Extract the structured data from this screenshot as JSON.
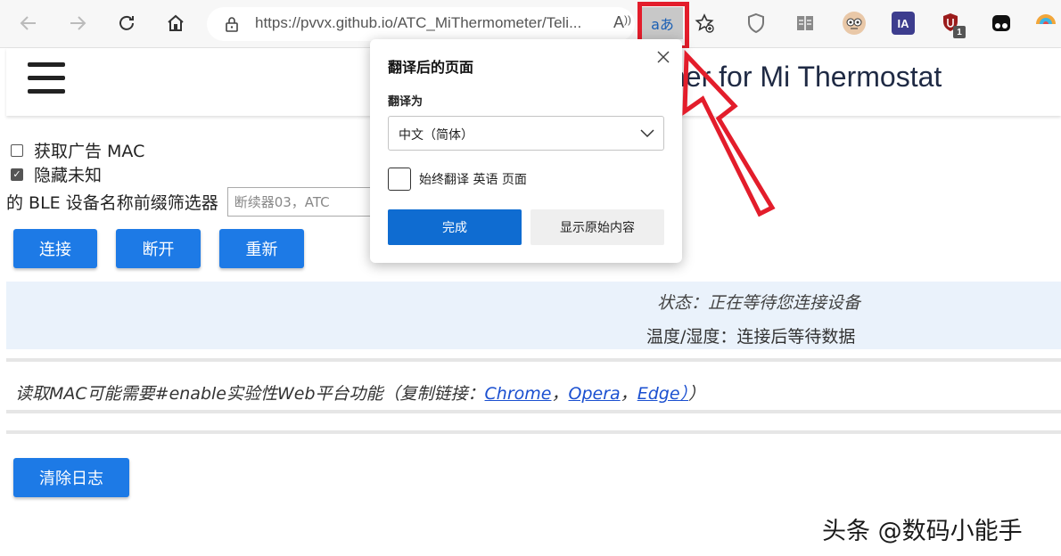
{
  "browser": {
    "url": "https://pvvx.github.io/ATC_MiThermometer/Teli...",
    "read_aloud_label": "A))",
    "translate_icon_label": "aあ",
    "extension_badges": {
      "ia": "IA",
      "ublock_count": "1"
    }
  },
  "page": {
    "title": "her for Mi Thermostat",
    "options": [
      {
        "label": "获取广告 MAC",
        "checked": false
      },
      {
        "label": "隐藏未知",
        "checked": true
      }
    ],
    "filter_label": "的 BLE 设备名称前缀筛选器",
    "filter_placeholder": "断续器03，ATC",
    "buttons": {
      "connect": "连接",
      "disconnect": "断开",
      "refresh": "重新"
    },
    "status": "状态：正在等待您连接设备",
    "temp_humidity": "温度/湿度：连接后等待数据",
    "info": {
      "prefix": "读取MAC可能需要#enable实验性Web平台功能（复制链接：",
      "link_chrome": "Chrome",
      "sep1": "，",
      "link_opera": "Opera",
      "sep2": "，",
      "link_edge": "Edge）",
      "suffix": "）"
    },
    "clear_log": "清除日志"
  },
  "translate_popup": {
    "title": "翻译后的页面",
    "translate_to_label": "翻译为",
    "language": "中文（简体）",
    "always_translate": "始终翻译 英语 页面",
    "done": "完成",
    "show_original": "显示原始内容"
  },
  "watermark": "头条 @数码小能手",
  "colors": {
    "accent_blue": "#1d7ae6",
    "highlight_red": "#e31d2b",
    "status_bg": "#eaf2fb"
  }
}
